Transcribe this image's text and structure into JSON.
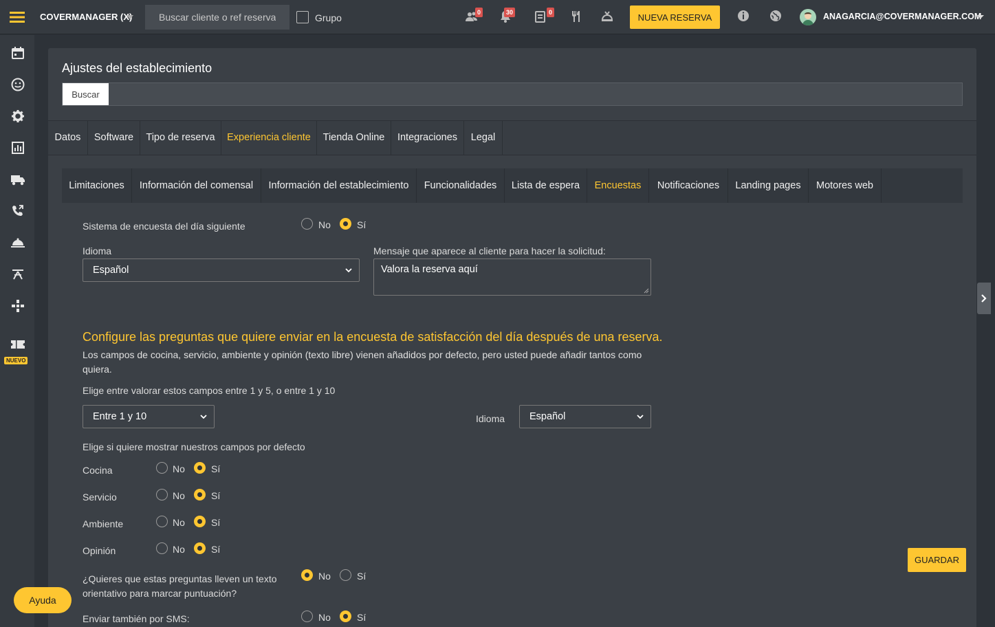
{
  "topbar": {
    "brand": "COVERMANAGER (X)",
    "search_placeholder": "Buscar cliente o ref reserva",
    "grupo_label": "Grupo",
    "badges": {
      "clients": "0",
      "notifications": "30",
      "tasks": "0"
    },
    "new_reservation": "NUEVA RESERVA",
    "user_email": "ANAGARCIA@COVERMANAGER.COM"
  },
  "sidebar": {
    "nuevo_badge": "NUEVO"
  },
  "page": {
    "title": "Ajustes del establecimiento",
    "search_button": "Buscar"
  },
  "tabs_primary": [
    "Datos",
    "Software",
    "Tipo de reserva",
    "Experiencia cliente",
    "Tienda Online",
    "Integraciones",
    "Legal"
  ],
  "tabs_secondary": [
    "Limitaciones",
    "Información del comensal",
    "Información del establecimiento",
    "Funcionalidades",
    "Lista de espera",
    "Encuestas",
    "Notificaciones",
    "Landing pages",
    "Motores web"
  ],
  "form": {
    "survey_label": "Sistema de encuesta del día siguiente",
    "no": "No",
    "si": "Sí",
    "language_label": "Idioma",
    "language_value": "Español",
    "message_label": "Mensaje que aparece al cliente para hacer la solicitud:",
    "message_value": "Valora la reserva aquí",
    "heading": "Configure las preguntas que quiere enviar en la encuesta de satisfacción del día después de una reserva.",
    "description": "Los campos de cocina, servicio, ambiente y opinión (texto libre) vienen añadidos por defecto, pero usted puede añadir tantos como quiera.",
    "scale_label": "Elige entre valorar estos campos entre 1 y 5, o entre 1 y 10",
    "scale_value": "Entre 1 y 10",
    "language2_label": "Idioma",
    "language2_value": "Español",
    "defaults_label": "Elige si quiere mostrar nuestros campos por defecto",
    "fields": [
      {
        "label": "Cocina",
        "selected": "si"
      },
      {
        "label": "Servicio",
        "selected": "si"
      },
      {
        "label": "Ambiente",
        "selected": "si"
      },
      {
        "label": "Opinión",
        "selected": "si"
      }
    ],
    "guide_question": "¿Quieres que estas preguntas lleven un texto orientativo para marcar puntuación?",
    "sms_label": "Enviar también por SMS:"
  },
  "buttons": {
    "save": "GUARDAR",
    "help": "Ayuda"
  },
  "colors": {
    "accent": "#fec631",
    "badge": "#d9534f",
    "background": "#2d3238",
    "panel": "#3b4046"
  }
}
